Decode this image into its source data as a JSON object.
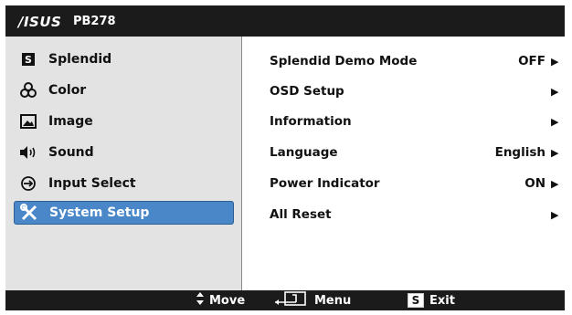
{
  "header": {
    "brand": "/ISUS",
    "model": "PB278"
  },
  "main_menu": [
    {
      "label": "Splendid",
      "icon": "splendid-icon",
      "active": false
    },
    {
      "label": "Color",
      "icon": "color-icon",
      "active": false
    },
    {
      "label": "Image",
      "icon": "image-icon",
      "active": false
    },
    {
      "label": "Sound",
      "icon": "sound-icon",
      "active": false
    },
    {
      "label": "Input Select",
      "icon": "input-select-icon",
      "active": false
    },
    {
      "label": "System Setup",
      "icon": "system-setup-icon",
      "active": true
    }
  ],
  "submenu": [
    {
      "label": "Splendid Demo Mode",
      "value": "OFF"
    },
    {
      "label": "OSD Setup",
      "value": ""
    },
    {
      "label": "Information",
      "value": ""
    },
    {
      "label": "Language",
      "value": "English"
    },
    {
      "label": "Power Indicator",
      "value": "ON"
    },
    {
      "label": "All Reset",
      "value": ""
    }
  ],
  "footer": {
    "move": "Move",
    "menu": "Menu",
    "exit_key": "S",
    "exit": "Exit"
  },
  "colors": {
    "active": "#4a87c8",
    "panel": "#e3e3e3",
    "frame": "#1b1b1b"
  }
}
